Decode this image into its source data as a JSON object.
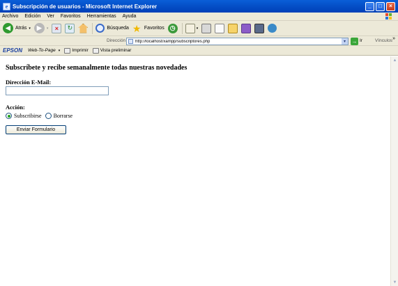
{
  "window": {
    "title": "Subscripción de usuarios - Microsoft Internet Explorer",
    "app_icon": "e",
    "controls": {
      "minimize": "_",
      "maximize": "□",
      "close": "×"
    }
  },
  "menu": {
    "items": [
      "Archivo",
      "Edición",
      "Ver",
      "Favoritos",
      "Herramientas",
      "Ayuda"
    ]
  },
  "toolbar": {
    "back_label": "Atrás",
    "search_label": "Búsqueda",
    "favorites_label": "Favoritos"
  },
  "address": {
    "label": "Dirección",
    "url": "http://localhost/xampp/subscriptores.php",
    "go_label": "Ir",
    "links_label": "Vínculos",
    "more": "»"
  },
  "epson": {
    "logo": "EPSON",
    "web_to_page": "Web-To-Page",
    "caret": "▾",
    "print_label": "Imprimir",
    "preview_label": "Vista preliminar"
  },
  "page": {
    "heading": "Subscríbete y recibe semanalmente todas nuestras novedades",
    "email_label": "Dirección E-Mail:",
    "email_value": "",
    "action_label": "Acción:",
    "options": [
      {
        "label": "Subscribirse",
        "selected": true
      },
      {
        "label": "Borrarse",
        "selected": false
      }
    ],
    "submit_label": "Enviar Formulario"
  },
  "colors": {
    "title_bar": "#0550c8",
    "chrome": "#ece9d8",
    "radio_selected": "#20a020"
  }
}
